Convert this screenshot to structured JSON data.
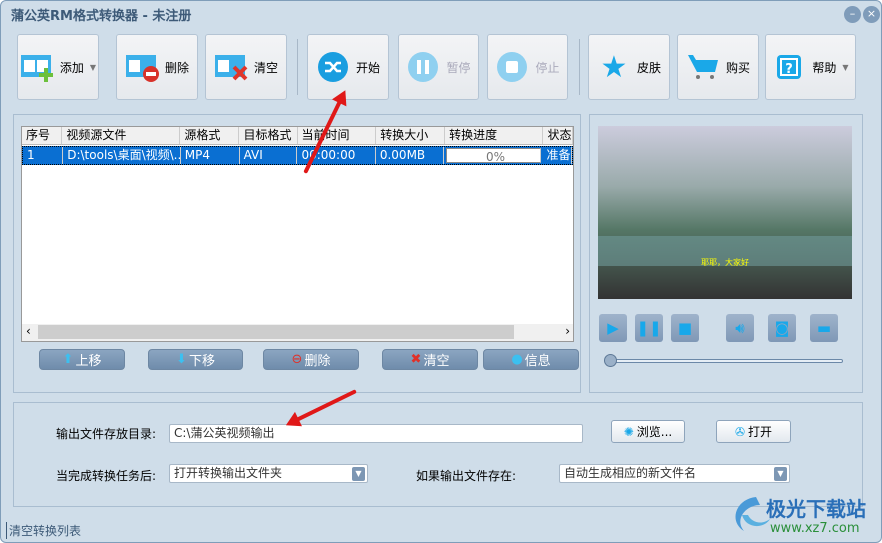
{
  "window": {
    "title": "蒲公英RM格式转换器 - 未注册",
    "minimize": "–",
    "close": "×"
  },
  "toolbar": [
    {
      "label": "添加",
      "icon": "film-add-icon",
      "dropdown": true,
      "enabled": true
    },
    {
      "label": "删除",
      "icon": "film-delete-icon",
      "enabled": true
    },
    {
      "label": "清空",
      "icon": "film-clear-icon",
      "enabled": true
    },
    {
      "label": "开始",
      "icon": "shuffle-start-icon",
      "enabled": true
    },
    {
      "label": "暂停",
      "icon": "pause-icon",
      "enabled": false
    },
    {
      "label": "停止",
      "icon": "stop-icon",
      "enabled": false
    },
    {
      "label": "皮肤",
      "icon": "star-icon",
      "enabled": true
    },
    {
      "label": "购买",
      "icon": "cart-icon",
      "enabled": true
    },
    {
      "label": "帮助",
      "icon": "help-icon",
      "dropdown": true,
      "enabled": true
    }
  ],
  "table": {
    "columns": [
      "序号",
      "视频源文件",
      "源格式",
      "目标格式",
      "当前时间",
      "转换大小",
      "转换进度",
      "状态"
    ],
    "rows": [
      {
        "index": "1",
        "file": "D:\\tools\\桌面\\视频\\...",
        "src": "MP4",
        "dst": "AVI",
        "time": "00:00:00",
        "size": "0.00MB",
        "progress": "0%",
        "status": "准备"
      }
    ]
  },
  "list_buttons": [
    "上移",
    "下移",
    "删除",
    "清空",
    "信息"
  ],
  "player": {
    "subtitle": "耶耶，大家好",
    "progress": 0
  },
  "output": {
    "dir_label": "输出文件存放目录:",
    "dir_value": "C:\\蒲公英视频输出",
    "browse": "浏览...",
    "open": "打开",
    "after_label": "当完成转换任务后:",
    "after_value": "打开转换输出文件夹",
    "exists_label": "如果输出文件存在:",
    "exists_value": "自动生成相应的新文件名"
  },
  "status": "清空转换列表",
  "watermark": {
    "name": "极光下载站",
    "url": "www.xz7.com"
  }
}
